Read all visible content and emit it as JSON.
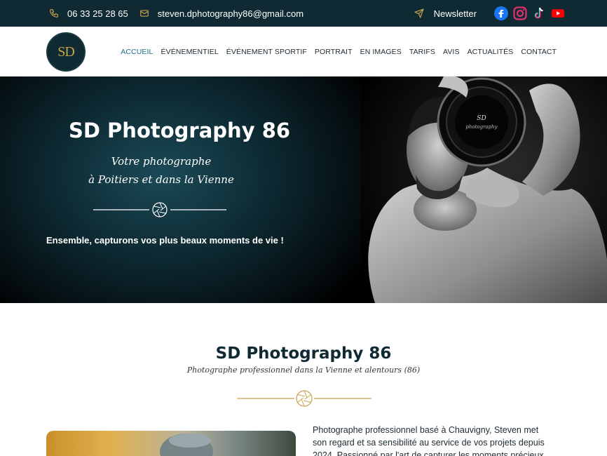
{
  "topbar": {
    "phone": "06 33 25 28 65",
    "email": "steven.dphotography86@gmail.com",
    "newsletter": "Newsletter",
    "socials": [
      "facebook-icon",
      "instagram-icon",
      "tiktok-icon",
      "youtube-icon"
    ]
  },
  "logo": {
    "text": "SD"
  },
  "nav": {
    "items": [
      "ACCUEIL",
      "ÉVÉNEMENTIEL",
      "ÉVÉNEMENT SPORTIF",
      "PORTRAIT",
      "EN IMAGES",
      "TARIFS",
      "AVIS",
      "ACTUALITÉS",
      "CONTACT"
    ],
    "active": "ACCUEIL"
  },
  "hero": {
    "title": "SD Photography 86",
    "script_line1": "Votre photographe",
    "script_line2": "à Poitiers et dans la Vienne",
    "tagline": "Ensemble, capturons vos plus beaux moments de vie !"
  },
  "intro": {
    "title": "SD Photography 86",
    "subtitle": "Photographe professionnel dans la Vienne et alentours (86)",
    "bio": "Photographe professionnel basé à Chauvigny, Steven met son regard et sa sensibilité au service de vos projets depuis 2024. Passionné par l'art de capturer les moments précieux, il vous"
  },
  "colors": {
    "topbar": "#0f2a33",
    "accent": "#1f6f8b",
    "gold": "#c9a24a"
  }
}
